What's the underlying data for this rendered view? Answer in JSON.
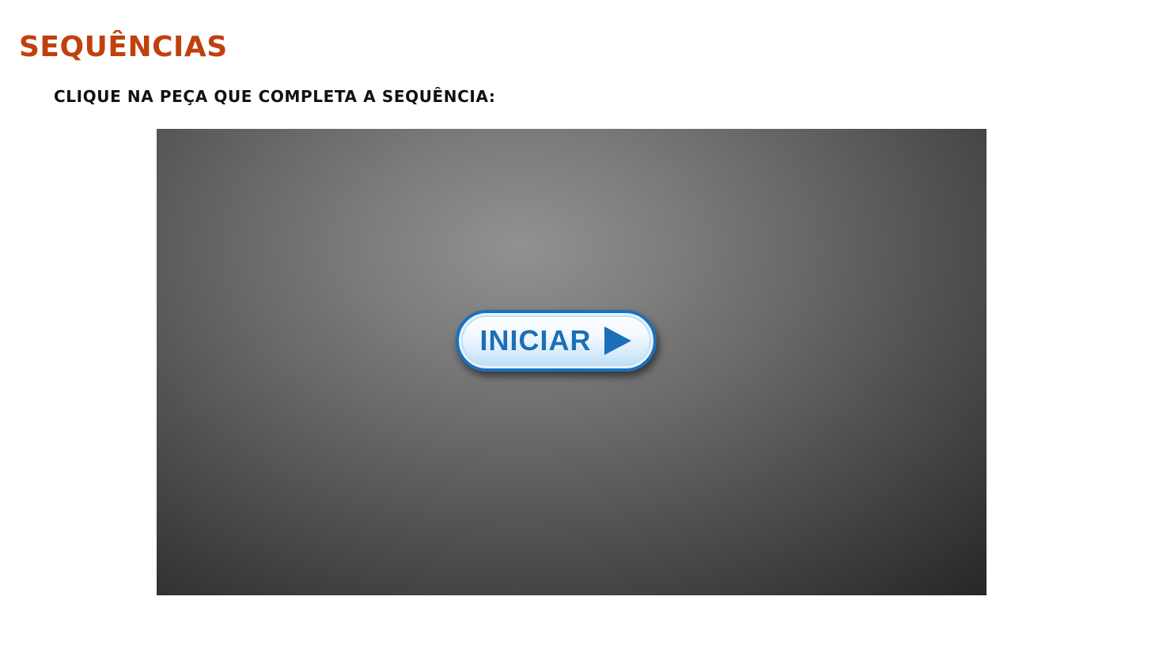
{
  "header": {
    "title": "SEQUÊNCIAS",
    "title_color": "#c0400e"
  },
  "instruction": {
    "text": "CLIQUE NA PEÇA QUE COMPLETA A SEQUÊNCIA:"
  },
  "game": {
    "start_button": {
      "label": "INICIAR",
      "icon": "play-icon",
      "color": "#1c6fb7"
    }
  }
}
